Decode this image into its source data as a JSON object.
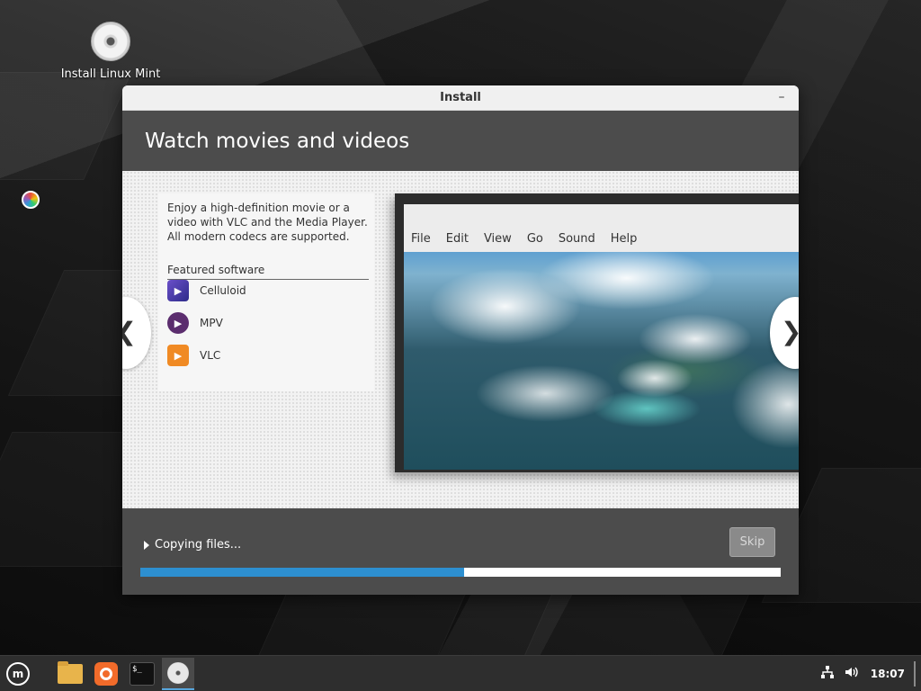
{
  "desktop": {
    "icon_label": "Install Linux Mint"
  },
  "window": {
    "title": "Install",
    "minimize_symbol": "–",
    "header_title": "Watch movies and videos"
  },
  "slide": {
    "description": "Enjoy a high-definition movie or a video with VLC and the Media Player. All modern codecs are supported.",
    "featured_title": "Featured software",
    "software": [
      {
        "name": "Celluloid",
        "icon": "celluloid-icon"
      },
      {
        "name": "MPV",
        "icon": "mpv-icon"
      },
      {
        "name": "VLC",
        "icon": "vlc-icon"
      }
    ],
    "menu": [
      "File",
      "Edit",
      "View",
      "Go",
      "Sound",
      "Help"
    ],
    "prev_symbol": "❮",
    "next_symbol": "❯"
  },
  "footer": {
    "status": "Copying files...",
    "skip_label": "Skip",
    "progress": 0.506
  },
  "taskbar": {
    "time": "18:07",
    "terminal_prompt": "$_"
  },
  "colors": {
    "header_bg": "#4c4c4c",
    "progress_fill": "#2d8fd0",
    "taskbar_bg": "#2e2e2e"
  }
}
